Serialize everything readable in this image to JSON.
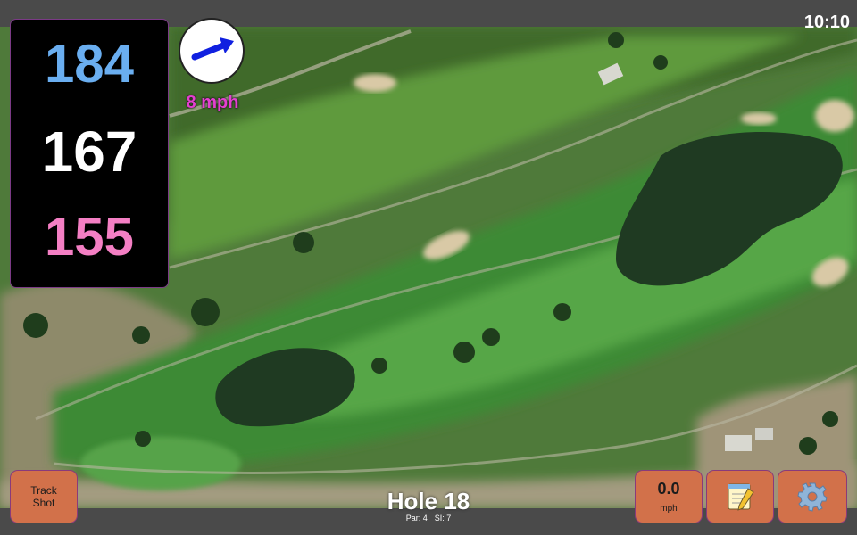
{
  "status_bar": {
    "time": "10:10"
  },
  "distances": {
    "back": "184",
    "middle": "167",
    "front": "155"
  },
  "wind": {
    "speed": "8 mph",
    "direction_icon": "arrow-up-right-icon"
  },
  "buttons": {
    "track_shot": {
      "line1": "Track",
      "line2": "Shot"
    },
    "speed": {
      "value": "0.0",
      "unit": "mph"
    },
    "notes_icon": "notepad-icon",
    "settings_icon": "gear-icon"
  },
  "hole": {
    "title": "Hole 18",
    "par": "Par: 4",
    "si": "SI: 7"
  },
  "colors": {
    "distance_back": "#6aaef0",
    "distance_middle": "#ffffff",
    "distance_front": "#f47fc4",
    "wind_text": "#e53fd1",
    "button_bg": "#d2714a"
  }
}
